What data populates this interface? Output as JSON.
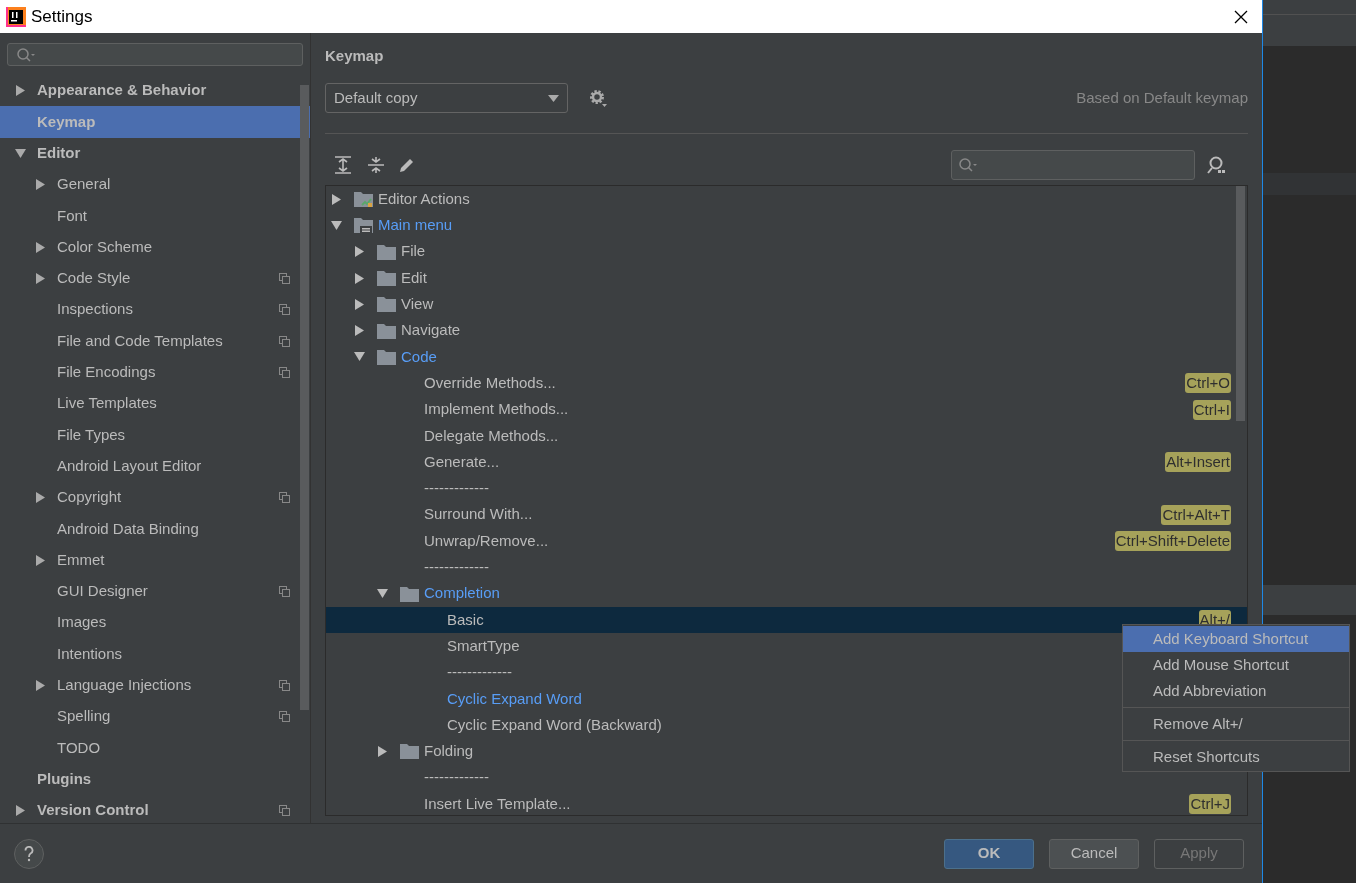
{
  "window": {
    "title": "Settings"
  },
  "sidebar": {
    "items": [
      {
        "label": "Appearance & Behavior",
        "expanded": false,
        "selected": false,
        "project_level": false
      },
      {
        "label": "Keymap",
        "selected": true,
        "project_level": false
      },
      {
        "label": "Editor",
        "expanded": true,
        "selected": false,
        "project_level": false,
        "children": [
          {
            "label": "General",
            "expanded": false,
            "selected": false,
            "project_level": false
          },
          {
            "label": "Font",
            "selected": false,
            "project_level": false
          },
          {
            "label": "Color Scheme",
            "expanded": false,
            "selected": false,
            "project_level": false
          },
          {
            "label": "Code Style",
            "expanded": false,
            "selected": false,
            "project_level": true
          },
          {
            "label": "Inspections",
            "selected": false,
            "project_level": true
          },
          {
            "label": "File and Code Templates",
            "selected": false,
            "project_level": true
          },
          {
            "label": "File Encodings",
            "selected": false,
            "project_level": true
          },
          {
            "label": "Live Templates",
            "selected": false,
            "project_level": false
          },
          {
            "label": "File Types",
            "selected": false,
            "project_level": false
          },
          {
            "label": "Android Layout Editor",
            "selected": false,
            "project_level": false
          },
          {
            "label": "Copyright",
            "expanded": false,
            "selected": false,
            "project_level": true
          },
          {
            "label": "Android Data Binding",
            "selected": false,
            "project_level": false
          },
          {
            "label": "Emmet",
            "expanded": false,
            "selected": false,
            "project_level": false
          },
          {
            "label": "GUI Designer",
            "selected": false,
            "project_level": true
          },
          {
            "label": "Images",
            "selected": false,
            "project_level": false
          },
          {
            "label": "Intentions",
            "selected": false,
            "project_level": false
          },
          {
            "label": "Language Injections",
            "expanded": false,
            "selected": false,
            "project_level": true
          },
          {
            "label": "Spelling",
            "selected": false,
            "project_level": true
          },
          {
            "label": "TODO",
            "selected": false,
            "project_level": false
          }
        ]
      },
      {
        "label": "Plugins",
        "selected": false,
        "project_level": false
      },
      {
        "label": "Version Control",
        "expanded": false,
        "selected": false,
        "project_level": true
      }
    ]
  },
  "keymap": {
    "heading": "Keymap",
    "scheme": "Default copy",
    "based_on": "Based on Default keymap",
    "tree": [
      {
        "kind": "editor-actions",
        "label": "Editor Actions",
        "expanded": false,
        "modified": false,
        "selected": false
      },
      {
        "kind": "main-menu",
        "label": "Main menu",
        "expanded": true,
        "modified": true,
        "selected": false,
        "children": [
          {
            "kind": "folder",
            "label": "File",
            "expanded": false,
            "modified": false,
            "selected": false
          },
          {
            "kind": "folder",
            "label": "Edit",
            "expanded": false,
            "modified": false,
            "selected": false
          },
          {
            "kind": "folder",
            "label": "View",
            "expanded": false,
            "modified": false,
            "selected": false
          },
          {
            "kind": "folder",
            "label": "Navigate",
            "expanded": false,
            "modified": false,
            "selected": false
          },
          {
            "kind": "folder",
            "label": "Code",
            "expanded": true,
            "modified": true,
            "selected": false,
            "children": [
              {
                "kind": "action",
                "label": "Override Methods...",
                "shortcut": "Ctrl+O",
                "modified": false,
                "selected": false
              },
              {
                "kind": "action",
                "label": "Implement Methods...",
                "shortcut": "Ctrl+I",
                "modified": false,
                "selected": false
              },
              {
                "kind": "action",
                "label": "Delegate Methods...",
                "modified": false,
                "selected": false
              },
              {
                "kind": "action",
                "label": "Generate...",
                "shortcut": "Alt+Insert",
                "modified": false,
                "selected": false
              },
              {
                "kind": "action",
                "label": "-------------",
                "modified": false,
                "selected": false
              },
              {
                "kind": "action",
                "label": "Surround With...",
                "shortcut": "Ctrl+Alt+T",
                "modified": false,
                "selected": false
              },
              {
                "kind": "action",
                "label": "Unwrap/Remove...",
                "shortcut": "Ctrl+Shift+Delete",
                "modified": false,
                "selected": false
              },
              {
                "kind": "action",
                "label": "-------------",
                "modified": false,
                "selected": false
              },
              {
                "kind": "folder",
                "label": "Completion",
                "expanded": true,
                "modified": true,
                "selected": false,
                "children": [
                  {
                    "kind": "action",
                    "label": "Basic",
                    "shortcut": "Alt+/",
                    "modified": false,
                    "selected": true
                  },
                  {
                    "kind": "action",
                    "label": "SmartType",
                    "modified": false,
                    "selected": false
                  },
                  {
                    "kind": "action",
                    "label": "-------------",
                    "modified": false,
                    "selected": false
                  },
                  {
                    "kind": "action",
                    "label": "Cyclic Expand Word",
                    "modified": true,
                    "selected": false
                  },
                  {
                    "kind": "action",
                    "label": "Cyclic Expand Word (Backward)",
                    "modified": false,
                    "selected": false
                  }
                ]
              },
              {
                "kind": "folder",
                "label": "Folding",
                "expanded": false,
                "modified": false,
                "selected": false
              },
              {
                "kind": "action",
                "label": "-------------",
                "modified": false,
                "selected": false
              },
              {
                "kind": "action",
                "label": "Insert Live Template...",
                "shortcut": "Ctrl+J",
                "modified": false,
                "selected": false
              }
            ]
          }
        ]
      }
    ]
  },
  "context_menu": {
    "groups": [
      [
        {
          "label": "Add Keyboard Shortcut",
          "selected": true
        },
        {
          "label": "Add Mouse Shortcut",
          "selected": false
        },
        {
          "label": "Add Abbreviation",
          "selected": false
        }
      ],
      [
        {
          "label": "Remove Alt+/",
          "selected": false
        }
      ],
      [
        {
          "label": "Reset Shortcuts",
          "selected": false
        }
      ]
    ]
  },
  "buttons": [
    {
      "label": "OK",
      "kind": "default",
      "disabled": false
    },
    {
      "label": "Cancel",
      "kind": "normal",
      "disabled": false
    },
    {
      "label": "Apply",
      "kind": "normal",
      "disabled": true
    }
  ]
}
